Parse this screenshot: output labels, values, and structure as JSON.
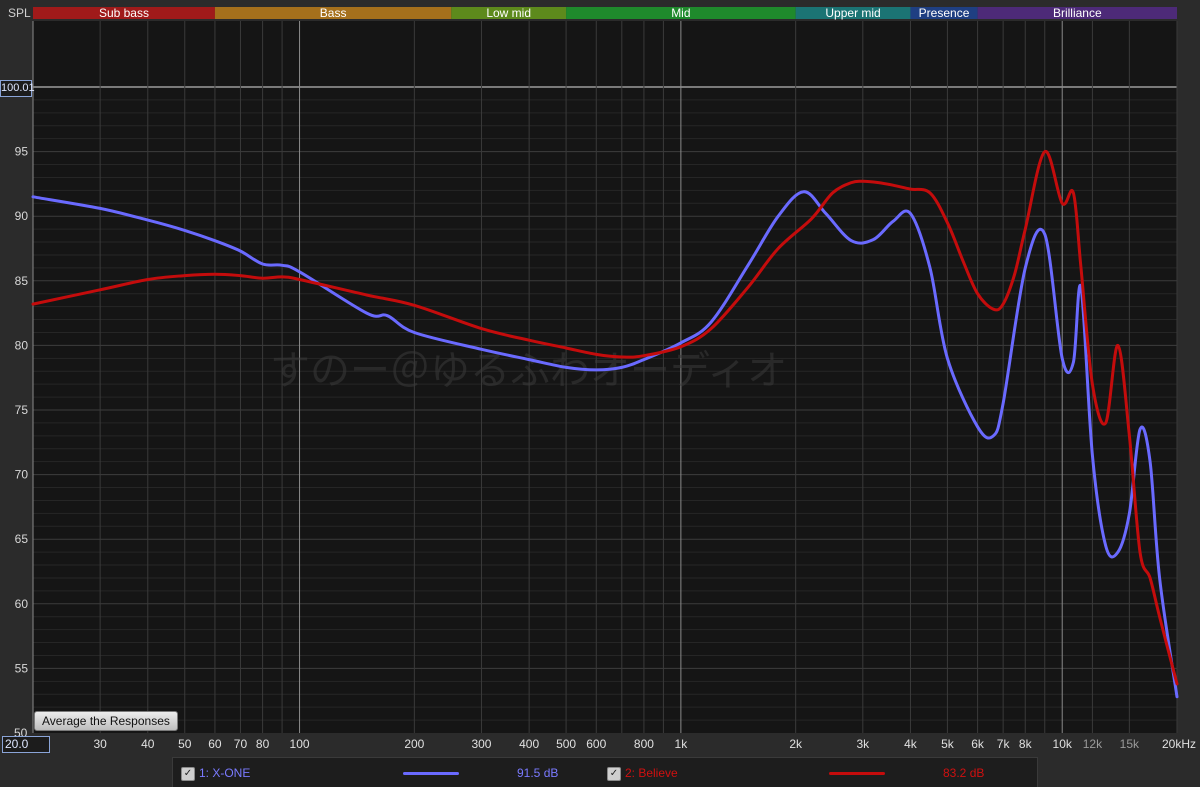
{
  "y_axis_label": "SPL",
  "x_min_field": "20.0",
  "y_max_field": "100.01",
  "average_button": "Average the Responses",
  "watermark": "すのー＠ゆるふわオーディオ",
  "bands": [
    {
      "name": "Sub bass",
      "from": 20,
      "to": 60,
      "color": "#a01a1a"
    },
    {
      "name": "Bass",
      "from": 60,
      "to": 250,
      "color": "#a5701c"
    },
    {
      "name": "Low mid",
      "from": 250,
      "to": 500,
      "color": "#5d8a1c"
    },
    {
      "name": "Mid",
      "from": 500,
      "to": 2000,
      "color": "#1f8a2c"
    },
    {
      "name": "Upper mid",
      "from": 2000,
      "to": 4000,
      "color": "#1b7474"
    },
    {
      "name": "Presence",
      "from": 4000,
      "to": 6000,
      "color": "#1f3f82"
    },
    {
      "name": "Brilliance",
      "from": 6000,
      "to": 20000,
      "color": "#4d2a78"
    }
  ],
  "legend": [
    {
      "label": "1: X-ONE",
      "value": "91.5 dB",
      "color": "#6a6aff",
      "checked": "✓"
    },
    {
      "label": "2: Believe",
      "value": "83.2 dB",
      "color": "#c40c0c",
      "checked": "✓"
    }
  ],
  "chart_data": {
    "type": "line",
    "xscale": "log",
    "xlim": [
      20,
      20000
    ],
    "ylim": [
      50,
      100
    ],
    "grid": true,
    "xticks": [
      {
        "v": 20,
        "label": "20.0"
      },
      {
        "v": 30,
        "label": "30"
      },
      {
        "v": 40,
        "label": "40"
      },
      {
        "v": 50,
        "label": "50"
      },
      {
        "v": 60,
        "label": "60"
      },
      {
        "v": 70,
        "label": "70"
      },
      {
        "v": 80,
        "label": "80"
      },
      {
        "v": 100,
        "label": "100"
      },
      {
        "v": 200,
        "label": "200"
      },
      {
        "v": 300,
        "label": "300"
      },
      {
        "v": 400,
        "label": "400"
      },
      {
        "v": 500,
        "label": "500"
      },
      {
        "v": 600,
        "label": "600"
      },
      {
        "v": 800,
        "label": "800"
      },
      {
        "v": 1000,
        "label": "1k"
      },
      {
        "v": 2000,
        "label": "2k"
      },
      {
        "v": 3000,
        "label": "3k"
      },
      {
        "v": 4000,
        "label": "4k"
      },
      {
        "v": 5000,
        "label": "5k"
      },
      {
        "v": 6000,
        "label": "6k"
      },
      {
        "v": 7000,
        "label": "7k"
      },
      {
        "v": 8000,
        "label": "8k"
      },
      {
        "v": 10000,
        "label": "10k"
      },
      {
        "v": 12000,
        "label": "12k"
      },
      {
        "v": 15000,
        "label": "15k"
      },
      {
        "v": 20000,
        "label": "20kHz"
      }
    ],
    "yticks": [
      55,
      60,
      65,
      70,
      75,
      80,
      85,
      90,
      95
    ],
    "series": [
      {
        "name": "1: X-ONE",
        "color": "#6a6aff",
        "x": [
          20,
          30,
          40,
          50,
          60,
          70,
          80,
          90,
          100,
          150,
          170,
          200,
          300,
          400,
          500,
          600,
          700,
          800,
          1000,
          1200,
          1500,
          1800,
          2100,
          2400,
          2800,
          3200,
          3600,
          4000,
          4500,
          5000,
          6000,
          6600,
          7000,
          8000,
          9000,
          10000,
          10700,
          11200,
          12000,
          13000,
          14000,
          15000,
          16000,
          17000,
          18000,
          20000
        ],
        "y": [
          91.5,
          90.6,
          89.7,
          88.9,
          88.1,
          87.3,
          86.3,
          86.2,
          85.7,
          82.5,
          82.3,
          81,
          79.7,
          78.9,
          78.3,
          78.1,
          78.3,
          78.9,
          80.2,
          81.8,
          86.2,
          90,
          91.9,
          90.2,
          88.1,
          88.2,
          89.6,
          90.2,
          86,
          79,
          73.7,
          73,
          75.5,
          86,
          88.6,
          79,
          78.7,
          84.5,
          71.5,
          64.5,
          64,
          67,
          73.5,
          71,
          62,
          52.8
        ]
      },
      {
        "name": "2: Believe",
        "color": "#c40c0c",
        "x": [
          20,
          30,
          40,
          50,
          60,
          70,
          80,
          90,
          100,
          150,
          200,
          300,
          400,
          500,
          600,
          700,
          800,
          1000,
          1200,
          1500,
          1800,
          2200,
          2500,
          2800,
          3000,
          3300,
          3600,
          4000,
          4500,
          5000,
          5500,
          6000,
          6600,
          7000,
          7500,
          8000,
          9000,
          10000,
          10700,
          11200,
          12000,
          13000,
          14000,
          15000,
          16000,
          17000,
          18000,
          20000
        ],
        "y": [
          83.2,
          84.3,
          85.1,
          85.4,
          85.5,
          85.4,
          85.2,
          85.3,
          85.1,
          83.9,
          83.1,
          81.3,
          80.4,
          79.8,
          79.3,
          79.1,
          79.2,
          79.9,
          81.3,
          84.5,
          87.5,
          89.8,
          91.8,
          92.6,
          92.7,
          92.6,
          92.4,
          92.1,
          91.8,
          89.5,
          86.5,
          84,
          82.8,
          83.2,
          85.5,
          89,
          95,
          91,
          91.8,
          86,
          77,
          74,
          80,
          73,
          64,
          62,
          59,
          53.8
        ]
      }
    ]
  }
}
